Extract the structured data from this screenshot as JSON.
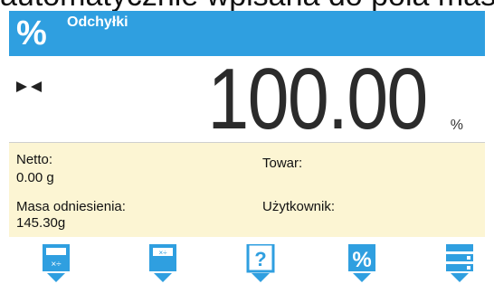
{
  "overlay_text": "automatycznie wpisana do pola masy",
  "header": {
    "icon": "percent-icon",
    "title": "Odchyłki",
    "color": "#2f9fe0"
  },
  "display": {
    "value": "100.00",
    "unit": "%",
    "indicator": "stable-indicator-icon"
  },
  "info": {
    "netto_label": "Netto:",
    "netto_value": "0.00 g",
    "towar_label": "Towar:",
    "masa_label": "Masa odniesienia:",
    "masa_value": "145.30g",
    "user_label": "Użytkownik:",
    "background": "#fcf5d3"
  },
  "buttons": [
    {
      "name": "calc-icon"
    },
    {
      "name": "calc-icon"
    },
    {
      "name": "help-icon",
      "glyph": "?"
    },
    {
      "name": "percent-icon",
      "glyph": "%"
    },
    {
      "name": "database-icon"
    }
  ]
}
